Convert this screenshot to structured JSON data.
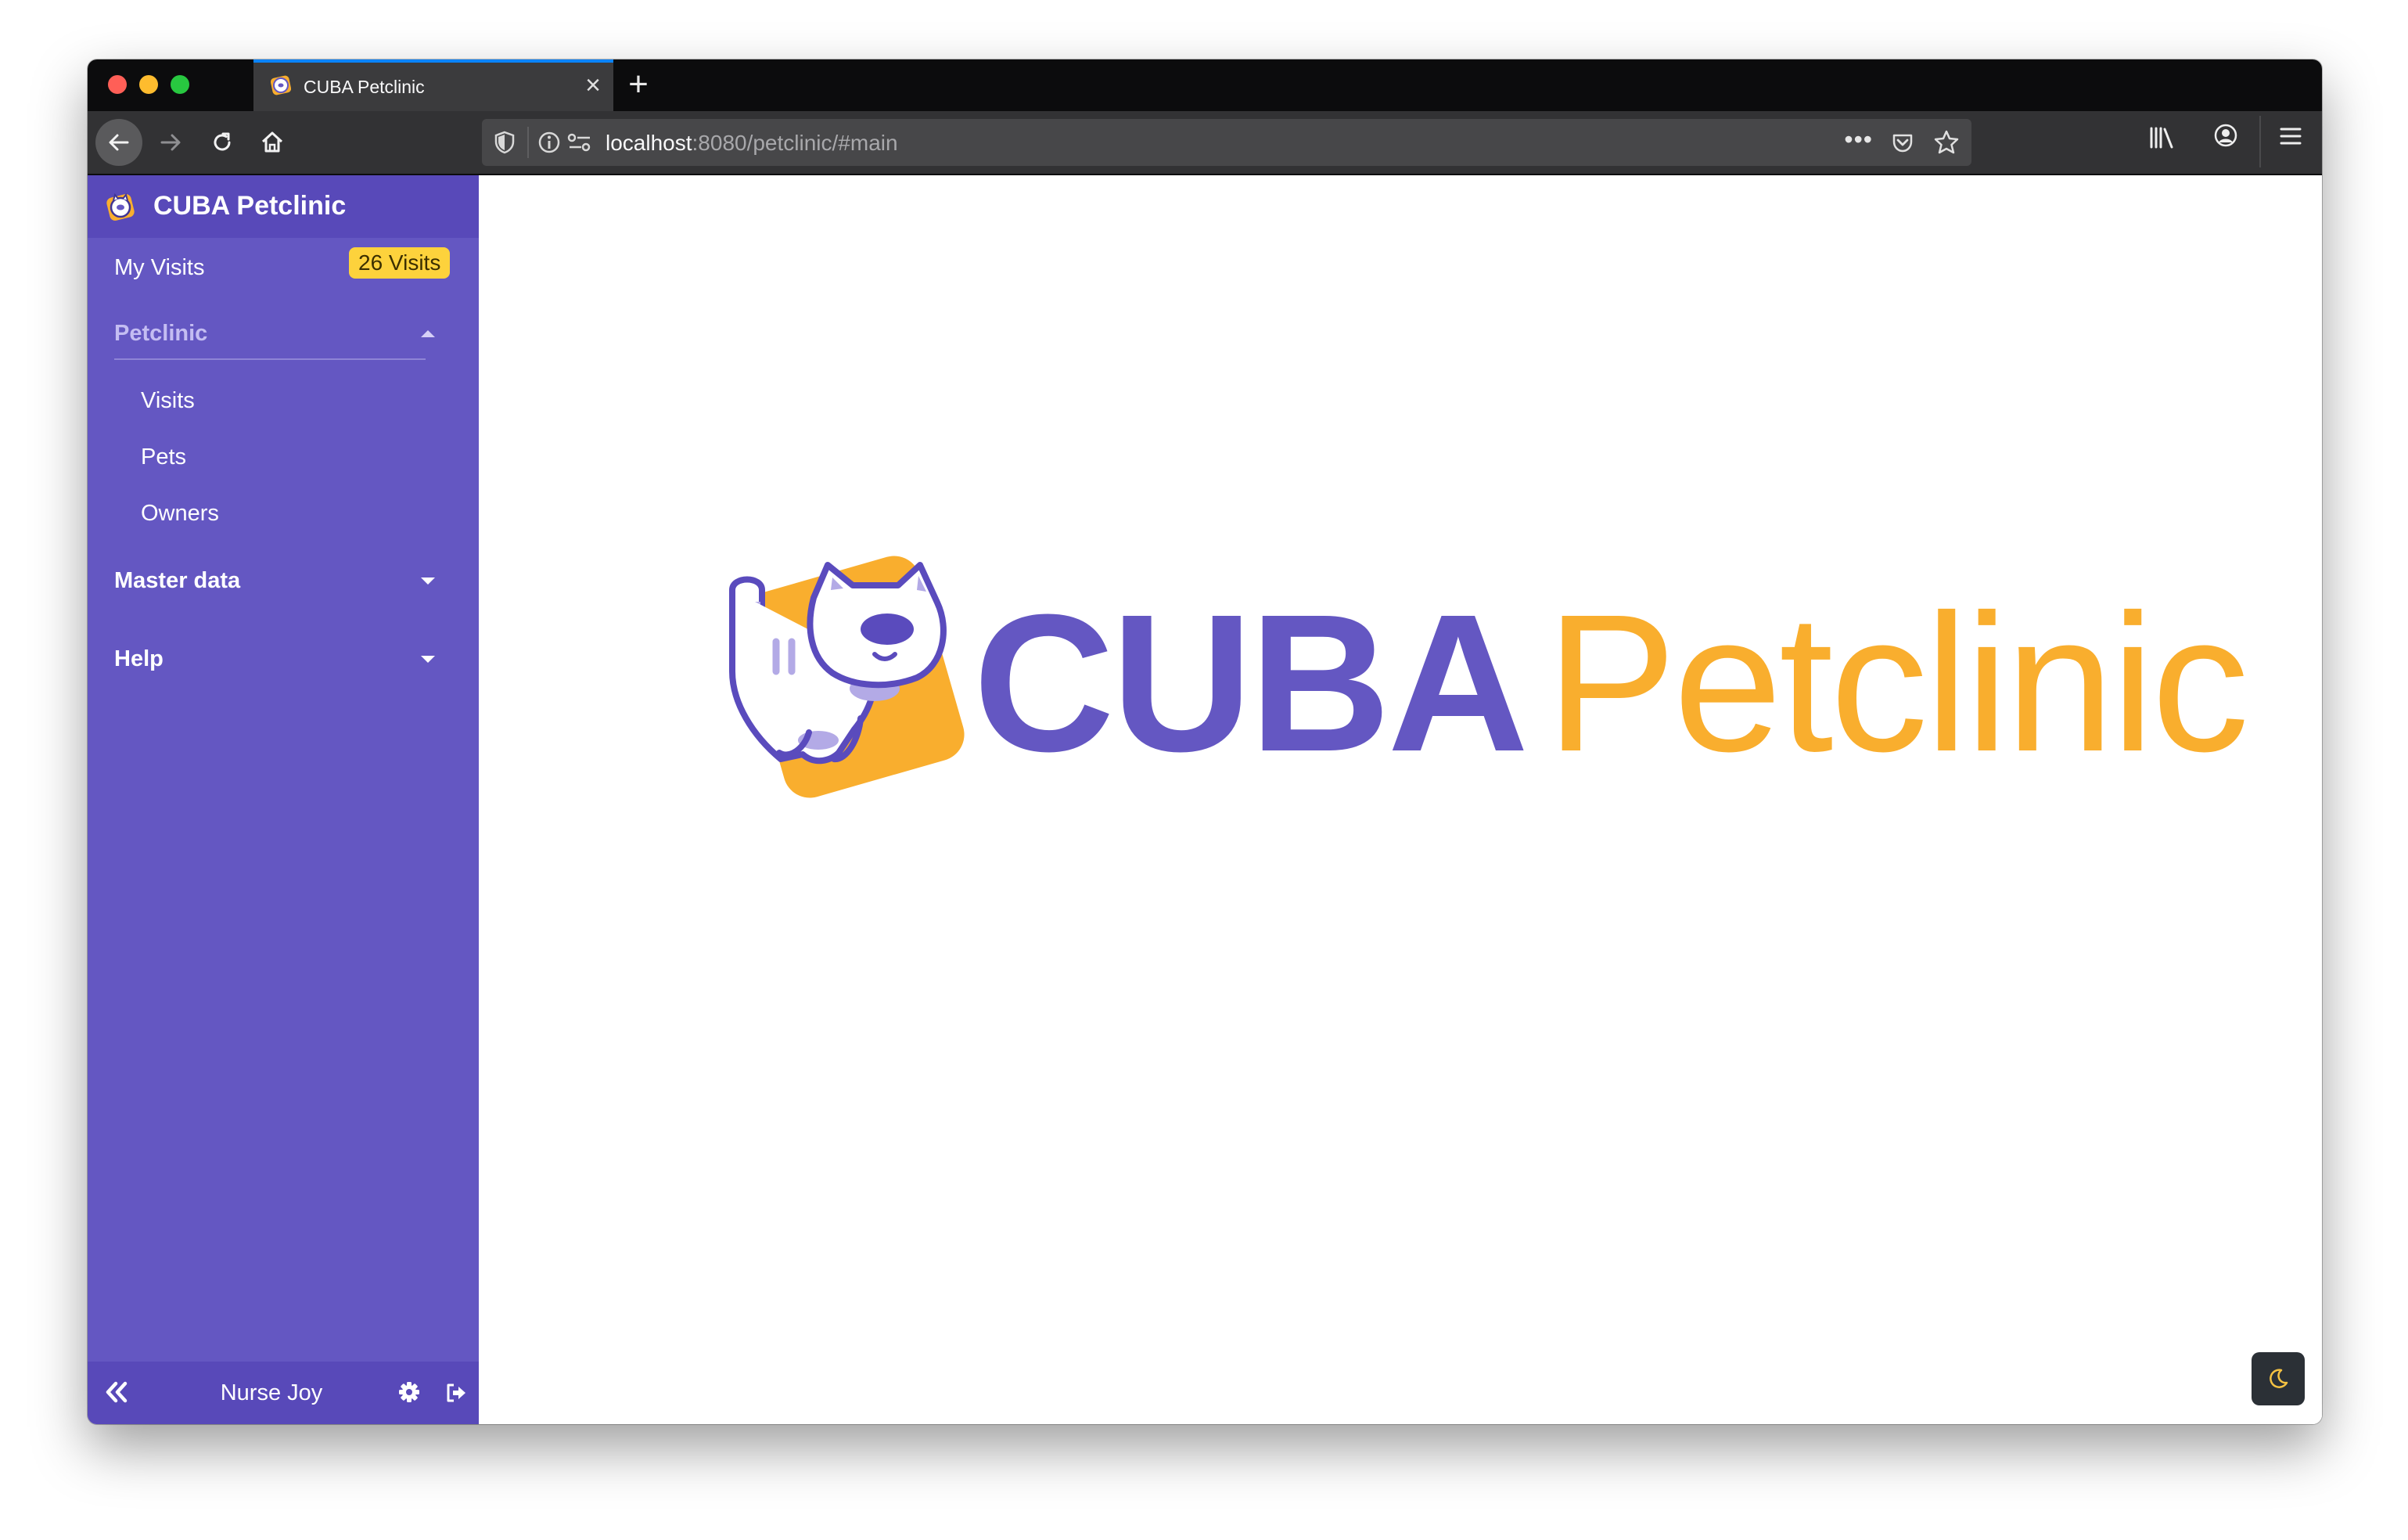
{
  "browser": {
    "tab": {
      "title": "CUBA Petclinic",
      "close_glyph": "×"
    },
    "new_tab_glyph": "+",
    "url": {
      "host": "localhost",
      "path": ":8080/petclinic/#main"
    },
    "more_glyph": "•••",
    "icons": [
      "back-icon",
      "forward-icon",
      "reload-icon",
      "home-icon",
      "shield-icon",
      "info-icon",
      "permissions-icon",
      "pocket-icon",
      "star-icon",
      "library-icon",
      "account-icon",
      "hamburger-menu-icon"
    ]
  },
  "sidebar": {
    "app_title": "CUBA Petclinic",
    "my_visits": {
      "label": "My Visits",
      "badge": "26 Visits"
    },
    "petclinic_group": {
      "label": "Petclinic",
      "expanded": true,
      "items": [
        {
          "label": "Visits"
        },
        {
          "label": "Pets"
        },
        {
          "label": "Owners"
        }
      ]
    },
    "master_data": {
      "label": "Master data",
      "expanded": false
    },
    "help": {
      "label": "Help",
      "expanded": false
    },
    "footer": {
      "username": "Nurse Joy"
    }
  },
  "main": {
    "logo": {
      "word1": "CUBA",
      "word2": "Petclinic"
    }
  },
  "colors": {
    "sidebar_bg": "#6457c2",
    "sidebar_header_bg": "#5849b9",
    "badge_bg": "#fdd23c",
    "brand_purple": "#6457c2",
    "brand_orange": "#f9ae2e",
    "theme_button_bg": "#2b3036"
  }
}
